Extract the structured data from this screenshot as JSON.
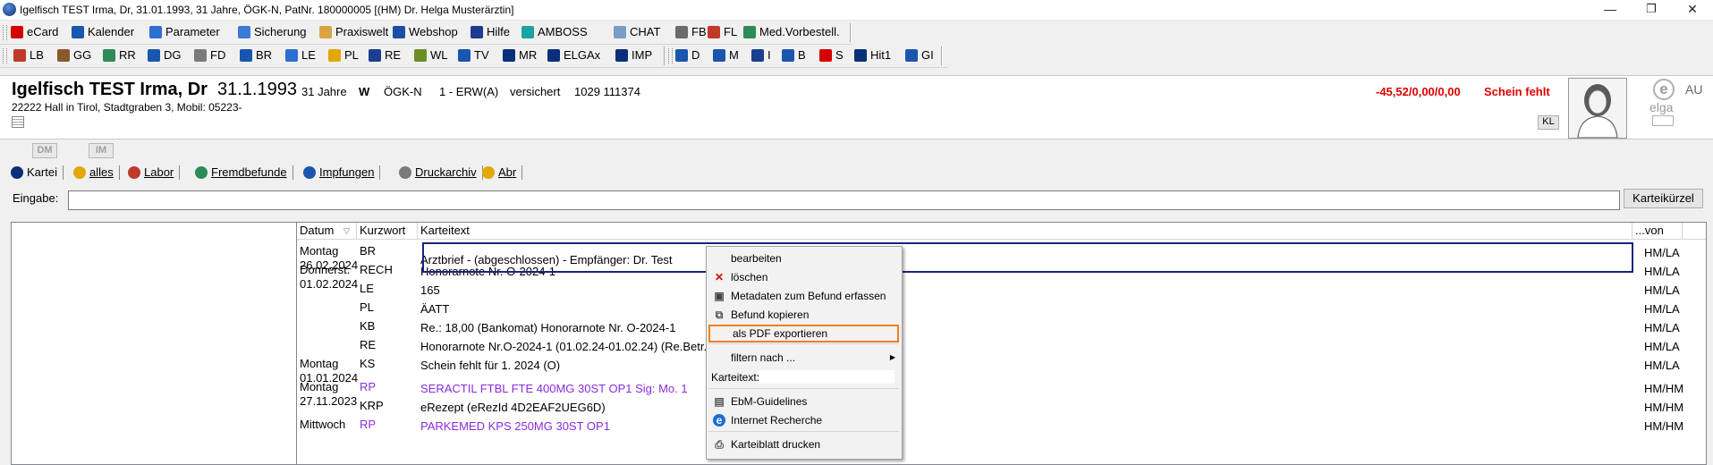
{
  "window": {
    "title": "Igelfisch TEST Irma, Dr, 31.01.1993, 31 Jahre, ÖGK-N, PatNr. 180000005 [(HM) Dr. Helga Musterärztin]",
    "minimize": "—",
    "restore": "❐",
    "close": "✕"
  },
  "toolbar1": {
    "items": [
      {
        "label": "eCard",
        "icon": "ecard-icon",
        "color": "#d40000"
      },
      {
        "label": "Kalender",
        "icon": "calendar-icon",
        "color": "#1a56b0"
      },
      {
        "label": "Parameter",
        "icon": "parameter-icon",
        "color": "#2c6fd1"
      },
      {
        "label": "Sicherung",
        "icon": "backup-icon",
        "color": "#3a7bd5"
      },
      {
        "label": "Praxiswelt",
        "icon": "hand-icon",
        "color": "#d9a441"
      },
      {
        "label": "Webshop",
        "icon": "cart-icon",
        "color": "#1b4ea3"
      },
      {
        "label": "Hilfe",
        "icon": "help-icon",
        "color": "#1b3c8f"
      },
      {
        "label": "AMBOSS",
        "icon": "amboss-icon",
        "color": "#1aa3a3"
      },
      {
        "label": "CHAT",
        "icon": "chat-icon",
        "color": "#7a9cc9"
      },
      {
        "label": "FB",
        "icon": "fb-icon",
        "color": "#6b6b6b"
      },
      {
        "label": "FL",
        "icon": "fl-icon",
        "color": "#c0392b"
      },
      {
        "label": "Med.Vorbestell.",
        "icon": "med-icon",
        "color": "#2e8b57"
      }
    ]
  },
  "toolbar2": {
    "groups": [
      [
        {
          "label": "LB",
          "icon": "lb-icon",
          "color": "#c0392b"
        },
        {
          "label": "GG",
          "icon": "gg-icon",
          "color": "#8b5a2b"
        },
        {
          "label": "RR",
          "icon": "rr-icon",
          "color": "#2e8b57"
        },
        {
          "label": "DG",
          "icon": "dg-icon",
          "color": "#1a56b0"
        },
        {
          "label": "FD",
          "icon": "fd-icon",
          "color": "#7a7a7a"
        },
        {
          "label": "BR",
          "icon": "br-icon",
          "color": "#1a56b0"
        },
        {
          "label": "LE",
          "icon": "le-icon",
          "color": "#2c6fd1"
        },
        {
          "label": "PL",
          "icon": "pl-icon",
          "color": "#e0a800"
        },
        {
          "label": "RE",
          "icon": "re-icon",
          "color": "#1a3f8f"
        },
        {
          "label": "WL",
          "icon": "wl-icon",
          "color": "#6b8e23"
        },
        {
          "label": "TV",
          "icon": "tv-icon",
          "color": "#1a56b0"
        },
        {
          "label": "MR",
          "icon": "mr-icon",
          "color": "#0b2f7a"
        },
        {
          "label": "ELGAx",
          "icon": "elgax-icon",
          "color": "#0b2f7a"
        },
        {
          "label": "IMP",
          "icon": "imp-icon",
          "color": "#0b2f7a"
        }
      ],
      [
        {
          "label": "D",
          "icon": "d-icon",
          "color": "#1a56b0"
        },
        {
          "label": "M",
          "icon": "m-icon",
          "color": "#1a56b0"
        },
        {
          "label": "I",
          "icon": "i-icon",
          "color": "#1a3f8f"
        },
        {
          "label": "B",
          "icon": "b-icon",
          "color": "#1a56b0"
        },
        {
          "label": "S",
          "icon": "s-icon",
          "color": "#d40000"
        },
        {
          "label": "Hit1",
          "icon": "hit1-icon",
          "color": "#0b2f7a"
        },
        {
          "label": "GI",
          "icon": "gi-icon",
          "color": "#1a56b0"
        }
      ]
    ]
  },
  "patient": {
    "name": "Igelfisch TEST Irma, Dr",
    "dob": "31.1.1993",
    "age": "31 Jahre",
    "sex": "W",
    "insurance": "ÖGK-N",
    "category": "1 - ERW(A)",
    "status": "versichert",
    "svnr": "1029 111374",
    "address": "22222 Hall in Tirol, Stadtgraben 3, Mobil: 05223-",
    "balance": "-45,52/0,00/0,00",
    "schein": "Schein fehlt",
    "kl_badge": "KL",
    "elga_label": "elga",
    "au_label": "AU"
  },
  "badges": {
    "dm": "DM",
    "im": "IM"
  },
  "tabs": [
    {
      "label": "Kartei",
      "icon": "kartei-icon",
      "color": "#0b2f7a"
    },
    {
      "label": "alles",
      "icon": "folder-icon",
      "color": "#e0a800"
    },
    {
      "label": "Labor",
      "icon": "labor-icon",
      "color": "#c0392b"
    },
    {
      "label": "Fremdbefunde",
      "icon": "fremdbefunde-icon",
      "color": "#2e8b57"
    },
    {
      "label": "Impfungen",
      "icon": "syringe-icon",
      "color": "#1a56b0"
    },
    {
      "label": "Druckarchiv",
      "icon": "printer-icon",
      "color": "#7a7a7a"
    },
    {
      "label": "Abr",
      "icon": "coin-icon",
      "color": "#e0a800"
    }
  ],
  "input": {
    "label": "Eingabe:",
    "value": "",
    "button": "Karteikürzel"
  },
  "grid": {
    "headers": {
      "datum": "Datum",
      "kurzwort": "Kurzwort",
      "text": "Karteitext",
      "von": "...von"
    },
    "rows": [
      {
        "date1": "Montag",
        "date2": "26.02.2024",
        "kw": "BR",
        "text": "Arztbrief - (abgeschlossen)  - Empfänger: Dr. Test",
        "von": "HM/LA",
        "color": "#000000"
      },
      {
        "date1": "Donnerst.",
        "date2": "01.02.2024",
        "kw": "RECH",
        "text": "Honorarnote Nr. O-2024-1",
        "von": "HM/LA",
        "color": "#000000"
      },
      {
        "date1": "",
        "date2": "",
        "kw": "LE",
        "text": "165",
        "von": "HM/LA",
        "color": "#000000"
      },
      {
        "date1": "",
        "date2": "",
        "kw": "PL",
        "text": "ÄATT",
        "von": "HM/LA",
        "color": "#000000"
      },
      {
        "date1": "",
        "date2": "",
        "kw": "KB",
        "text": "Re.: 18,00 (Bankomat) Honorarnote Nr. O-2024-1",
        "von": "HM/LA",
        "color": "#000000"
      },
      {
        "date1": "",
        "date2": "",
        "kw": "RE",
        "text": "Honorarnote Nr.O-2024-1 (01.02.24-01.02.24) (Re.Betr.:",
        "von": "HM/LA",
        "color": "#000000"
      },
      {
        "date1": "Montag",
        "date2": "01.01.2024",
        "kw": "KS",
        "text": "Schein fehlt für 1. 2024 (O)",
        "von": "HM/LA",
        "color": "#000000"
      },
      {
        "date1": "Montag",
        "date2": "27.11.2023",
        "kw": "RP",
        "text": "SERACTIL FTBL FTE 400MG 30ST  OP1    Sig: Mo. 1",
        "von": "HM/HM",
        "color": "#8a2be2"
      },
      {
        "date1": "",
        "date2": "",
        "kw": "KRP",
        "text": "eRezept (eRezId 4D2EAF2UEG6D)",
        "von": "HM/HM",
        "color": "#000000"
      },
      {
        "date1": "Mittwoch",
        "date2": "",
        "kw": "RP",
        "text": "PARKEMED KPS 250MG 30ST  OP1",
        "von": "HM/HM",
        "color": "#8a2be2"
      }
    ]
  },
  "context_menu": {
    "items": [
      {
        "label": "bearbeiten",
        "icon": "",
        "color": ""
      },
      {
        "label": "löschen",
        "icon": "delete-icon",
        "color": "#d40000"
      },
      {
        "label": "Metadaten zum Befund erfassen",
        "icon": "metadata-icon",
        "color": "#444444"
      },
      {
        "label": "Befund kopieren",
        "icon": "copy-icon",
        "color": "#555555"
      },
      {
        "label": "als PDF exportieren",
        "icon": "",
        "color": ""
      },
      {
        "label": "filtern nach ...",
        "icon": "",
        "color": ""
      },
      {
        "label": "Karteitext:",
        "icon": "",
        "color": ""
      },
      {
        "label": "EbM-Guidelines",
        "icon": "ebm-icon",
        "color": "#555555"
      },
      {
        "label": "Internet Recherche",
        "icon": "internet-icon",
        "color": "#1a6fd6"
      },
      {
        "label": "Karteiblatt drucken",
        "icon": "print-icon",
        "color": "#555555"
      }
    ],
    "highlight_color": "#f07f1c"
  }
}
